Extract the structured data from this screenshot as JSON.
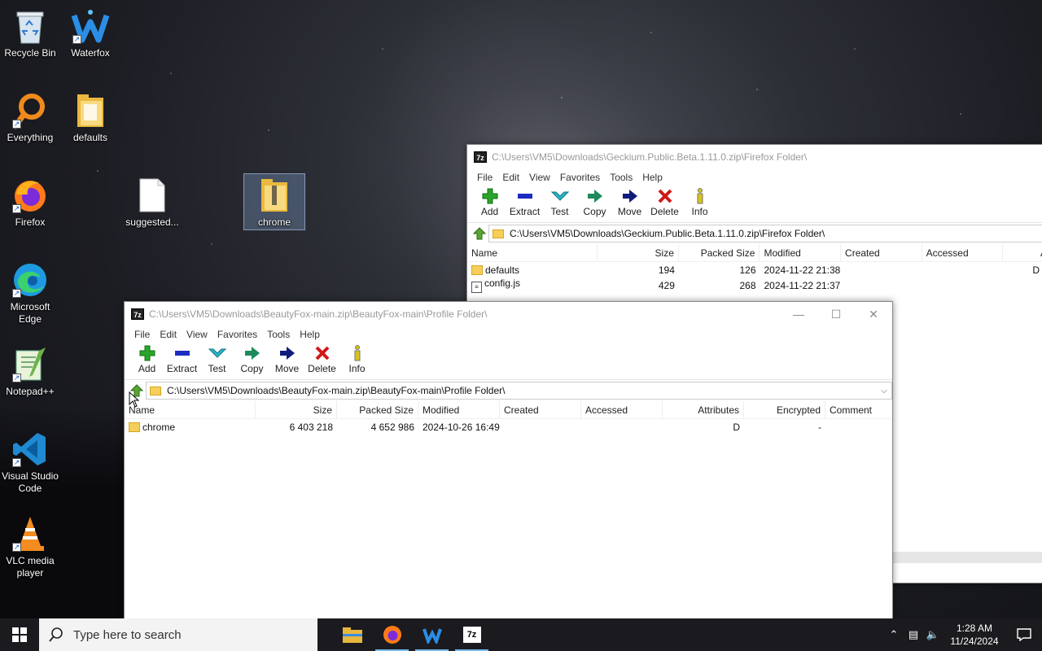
{
  "desktop": {
    "icons": [
      {
        "label": "Recycle Bin"
      },
      {
        "label": "Waterfox"
      },
      {
        "label": "Everything"
      },
      {
        "label": "defaults"
      },
      {
        "label": "Firefox"
      },
      {
        "label": "suggested..."
      },
      {
        "label": "chrome"
      },
      {
        "label": "Microsoft Edge"
      },
      {
        "label": "Notepad++"
      },
      {
        "label": "Visual Studio Code"
      },
      {
        "label": "VLC media player"
      }
    ]
  },
  "back_window": {
    "title": "C:\\Users\\VM5\\Downloads\\Geckium.Public.Beta.1.11.0.zip\\Firefox Folder\\",
    "menu": [
      "File",
      "Edit",
      "View",
      "Favorites",
      "Tools",
      "Help"
    ],
    "toolbar": [
      "Add",
      "Extract",
      "Test",
      "Copy",
      "Move",
      "Delete",
      "Info"
    ],
    "address": "C:\\Users\\VM5\\Downloads\\Geckium.Public.Beta.1.11.0.zip\\Firefox Folder\\",
    "columns": [
      "Name",
      "Size",
      "Packed Size",
      "Modified",
      "Created",
      "Accessed",
      "A"
    ],
    "rows": [
      {
        "name": "defaults",
        "size": "194",
        "packed": "126",
        "modified": "2024-11-22 21:38",
        "attr": "D d"
      },
      {
        "name": "config.js",
        "size": "429",
        "packed": "268",
        "modified": "2024-11-22 21:37",
        "attr": "-"
      }
    ]
  },
  "front_window": {
    "title": "C:\\Users\\VM5\\Downloads\\BeautyFox-main.zip\\BeautyFox-main\\Profile Folder\\",
    "caption": {
      "minimize": "—",
      "maximize": "☐",
      "close": "✕"
    },
    "menu": [
      "File",
      "Edit",
      "View",
      "Favorites",
      "Tools",
      "Help"
    ],
    "toolbar": [
      "Add",
      "Extract",
      "Test",
      "Copy",
      "Move",
      "Delete",
      "Info"
    ],
    "address": "C:\\Users\\VM5\\Downloads\\BeautyFox-main.zip\\BeautyFox-main\\Profile Folder\\",
    "columns": [
      "Name",
      "Size",
      "Packed Size",
      "Modified",
      "Created",
      "Accessed",
      "Attributes",
      "Encrypted",
      "Comment"
    ],
    "rows": [
      {
        "name": "chrome",
        "size": "6 403 218",
        "packed": "4 652 986",
        "modified": "2024-10-26 16:49",
        "created": "",
        "accessed": "",
        "attributes": "D",
        "encrypted": "-",
        "comment": ""
      }
    ]
  },
  "taskbar": {
    "search_placeholder": "Type here to search",
    "apps": [
      "file-explorer",
      "firefox",
      "waterfox",
      "7-zip"
    ],
    "time": "1:28 AM",
    "date": "11/24/2024"
  },
  "colors": {
    "taskbar": "#1b1b1f",
    "folder": "#f6cf5a",
    "add_green": "#2aa52a",
    "extract_blue": "#1c2cc2",
    "test_teal": "#2bb7c7",
    "delete_red": "#d01818"
  }
}
